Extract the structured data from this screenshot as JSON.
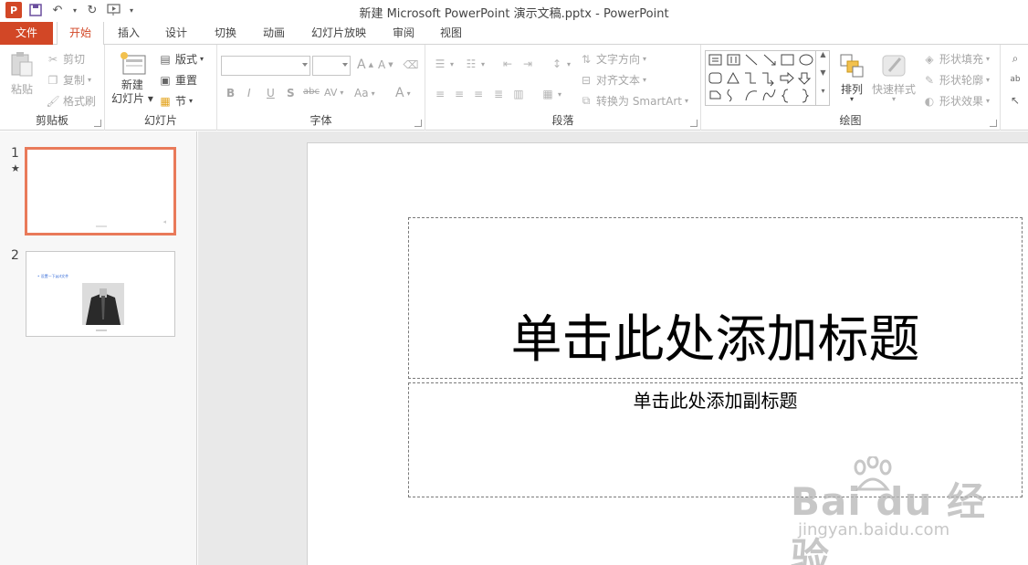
{
  "app": {
    "window_title": "新建 Microsoft PowerPoint 演示文稿.pptx - PowerPoint",
    "logo_letter": "P",
    "accent_color": "#d24726"
  },
  "tabs": [
    {
      "label": "文件"
    },
    {
      "label": "开始"
    },
    {
      "label": "插入"
    },
    {
      "label": "设计"
    },
    {
      "label": "切换"
    },
    {
      "label": "动画"
    },
    {
      "label": "幻灯片放映"
    },
    {
      "label": "审阅"
    },
    {
      "label": "视图"
    }
  ],
  "ribbon": {
    "clipboard": {
      "label": "剪贴板",
      "paste": "粘贴",
      "cut": "剪切",
      "copy": "复制",
      "format_painter": "格式刷"
    },
    "slides": {
      "label": "幻灯片",
      "new_slide_line1": "新建",
      "new_slide_line2": "幻灯片",
      "layout": "版式",
      "reset": "重置",
      "section": "节"
    },
    "font": {
      "label": "字体",
      "bold": "B",
      "italic": "I",
      "underline": "U",
      "shadow": "S",
      "strike": "abc",
      "spacing": "AV",
      "case": "Aa",
      "color": "A",
      "grow": "A",
      "shrink": "A"
    },
    "paragraph": {
      "label": "段落",
      "text_direction": "文字方向",
      "align_text": "对齐文本",
      "convert_smartart": "转换为 SmartArt"
    },
    "drawing": {
      "label": "绘图",
      "arrange": "排列",
      "quick_styles": "快速样式",
      "shape_fill": "形状填充",
      "shape_outline": "形状轮廓",
      "shape_effects": "形状效果"
    }
  },
  "slides": [
    {
      "number": "1"
    },
    {
      "number": "2",
      "link_text": "• 设置一下ppt文件"
    }
  ],
  "main_slide": {
    "title_placeholder": "单击此处添加标题",
    "subtitle_placeholder": "单击此处添加副标题"
  },
  "watermark": {
    "main": "Bai du 经验",
    "sub": "jingyan.baidu.com"
  }
}
